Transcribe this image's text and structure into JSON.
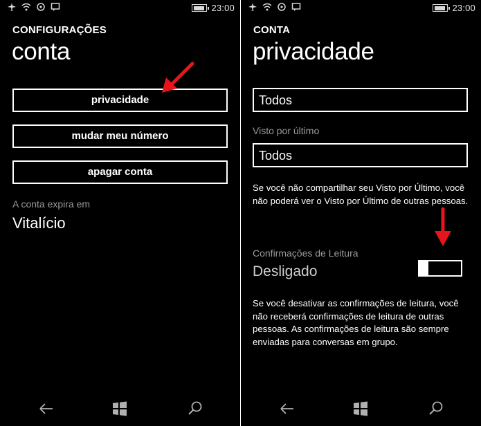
{
  "status_bar": {
    "icons": [
      "airplane-icon",
      "wifi-icon",
      "location-icon",
      "message-icon"
    ],
    "time": "23:00"
  },
  "left": {
    "section": "CONFIGURAÇÕES",
    "title": "conta",
    "buttons": [
      "privacidade",
      "mudar meu número",
      "apagar conta"
    ],
    "expiry_label": "A conta expira em",
    "expiry_value": "Vitalício"
  },
  "right": {
    "section": "CONTA",
    "title": "privacidade",
    "first_select_value": "Todos",
    "last_seen_label": "Visto por último",
    "last_seen_value": "Todos",
    "last_seen_note": "Se você não compartilhar seu Visto por Último, você não poderá ver o Visto por Último de outras pessoas.",
    "read_receipts_label": "Confirmações de Leitura",
    "read_receipts_state": "Desligado",
    "read_receipts_on": false,
    "read_receipts_note": "Se você desativar as confirmações de leitura, você não receberá confirmações de leitura de outras pessoas. As confirmações de leitura são sempre enviadas para conversas em grupo."
  },
  "nav_icons": [
    "back-icon",
    "windows-start-icon",
    "search-icon"
  ],
  "colors": {
    "background": "#000000",
    "foreground": "#ffffff",
    "muted": "#9a9a9a",
    "annotation_arrow": "#e8141b"
  }
}
